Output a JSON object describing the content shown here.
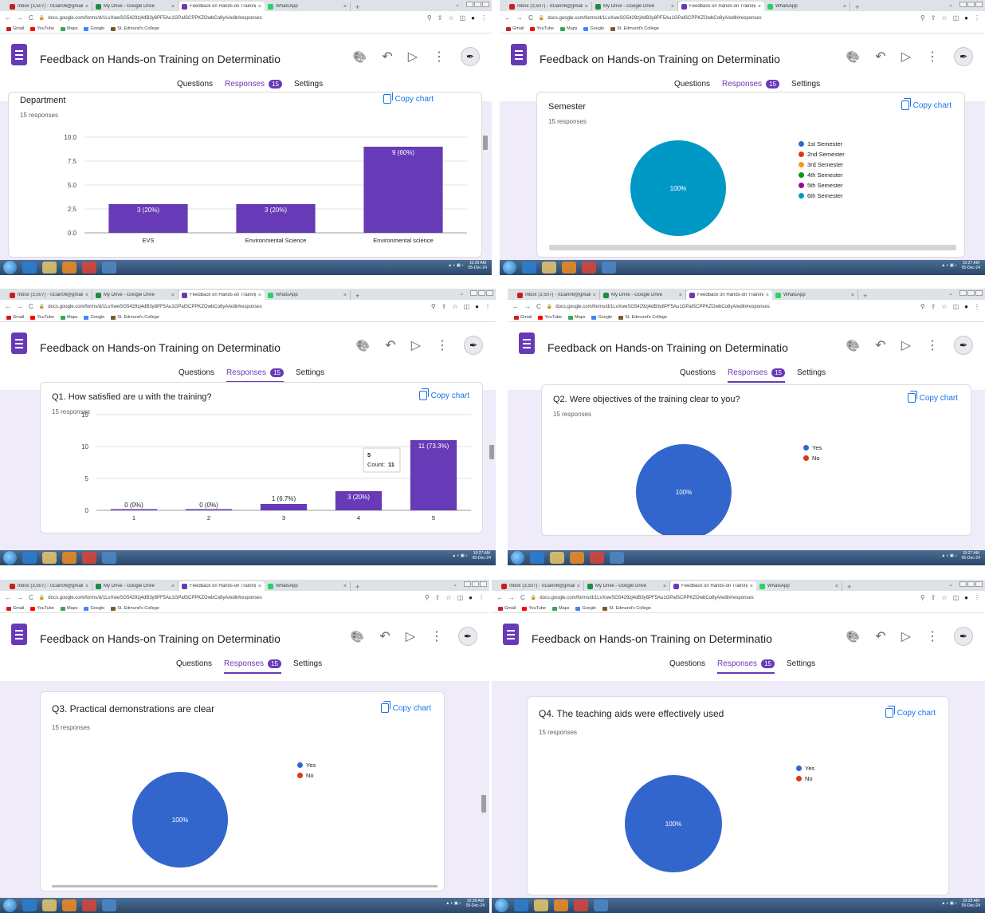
{
  "browser": {
    "tabs": [
      {
        "label": "Inbox (3,507) - 01lan06@gmail.c",
        "color": "#c5221f"
      },
      {
        "label": "My Drive - Google Drive",
        "color": "#1e8e3e"
      },
      {
        "label": "Feedback on Hands-on Training",
        "color": "#673ab7"
      },
      {
        "label": "WhatsApp",
        "color": "#25d366"
      }
    ],
    "new_tab": "+",
    "url": "docs.google.com/forms/d/1LvXweSG5429zj4dB3y8PF5Au1GPalSCPPKZOwbCo8yA/edit#responses",
    "bookmarks": [
      {
        "label": "Gmail",
        "color": "#c5221f"
      },
      {
        "label": "YouTube",
        "color": "#ff0000"
      },
      {
        "label": "Maps",
        "color": "#34a853"
      },
      {
        "label": "Google",
        "color": "#4285f4"
      },
      {
        "label": "St. Edmund's College",
        "color": "#7b5b2a"
      }
    ]
  },
  "form": {
    "title": "Feedback on Hands-on Training on Determinatio",
    "tabs": {
      "questions": "Questions",
      "responses": "Responses",
      "responses_count": "15",
      "settings": "Settings"
    },
    "copy_chart": "Copy chart"
  },
  "taskbar": {
    "times": [
      "10:26 AM",
      "10:27 AM",
      "10:27 AM",
      "10:27 AM",
      "10:28 AM",
      "10:28 AM"
    ],
    "date": "05-Dec-24"
  },
  "panels": [
    {
      "title": "Department",
      "responses": "15 responses",
      "chart_data": {
        "type": "bar",
        "title": "Department",
        "categories": [
          "EVS",
          "Environmental Science",
          "Environmental science"
        ],
        "values": [
          3,
          3,
          9
        ],
        "data_labels": [
          "3 (20%)",
          "3 (20%)",
          "9 (60%)"
        ],
        "yticks": [
          "10.0",
          "7.5",
          "5.0",
          "2.5",
          "0.0"
        ],
        "ylim": [
          0,
          10
        ],
        "color": "#673ab7",
        "grid": true
      }
    },
    {
      "title": "Semester",
      "responses": "15 responses",
      "chart_data": {
        "type": "pie",
        "title": "Semester",
        "labels": [
          "1st Semester",
          "2nd Semester",
          "3rd Semester",
          "4th Semester",
          "5th Semester",
          "6th Semester"
        ],
        "values": [
          0,
          0,
          0,
          0,
          0,
          15
        ],
        "colors": [
          "#3366cc",
          "#dc3912",
          "#ff9900",
          "#109618",
          "#990099",
          "#0099c6"
        ],
        "slice_label": "100%",
        "legend": "right"
      }
    },
    {
      "title": "Q1. How satisfied are u with the training?",
      "responses": "15 responses",
      "tooltip": {
        "title": "5",
        "count_label": "Count:",
        "count": "11"
      },
      "chart_data": {
        "type": "bar",
        "title": "Q1. How satisfied are u with the training?",
        "categories": [
          "1",
          "2",
          "3",
          "4",
          "5"
        ],
        "values": [
          0,
          0,
          1,
          3,
          11
        ],
        "data_labels": [
          "0 (0%)",
          "0 (0%)",
          "1 (6.7%)",
          "3 (20%)",
          "11 (73.3%)"
        ],
        "yticks": [
          "15",
          "10",
          "5",
          "0"
        ],
        "ylim": [
          0,
          15
        ],
        "color": "#673ab7",
        "grid": true
      }
    },
    {
      "title": "Q2. Were objectives of the training clear to you?",
      "responses": "15 responses",
      "chart_data": {
        "type": "pie",
        "title": "Q2. Were objectives of the training clear to you?",
        "labels": [
          "Yes",
          "No"
        ],
        "values": [
          15,
          0
        ],
        "colors": [
          "#3366cc",
          "#dc3912"
        ],
        "slice_label": "100%",
        "legend": "right"
      }
    },
    {
      "title": "Q3. Practical demonstrations are clear",
      "responses": "15 responses",
      "chart_data": {
        "type": "pie",
        "title": "Q3. Practical demonstrations are clear",
        "labels": [
          "Yes",
          "No"
        ],
        "values": [
          15,
          0
        ],
        "colors": [
          "#3366cc",
          "#dc3912"
        ],
        "slice_label": "100%",
        "legend": "right"
      }
    },
    {
      "title": "Q4.  The teaching aids were effectively used",
      "responses": "15 responses",
      "chart_data": {
        "type": "pie",
        "title": "Q4.  The teaching aids were effectively used",
        "labels": [
          "Yes",
          "No"
        ],
        "values": [
          15,
          0
        ],
        "colors": [
          "#3366cc",
          "#dc3912"
        ],
        "slice_label": "100%",
        "legend": "right"
      }
    }
  ]
}
